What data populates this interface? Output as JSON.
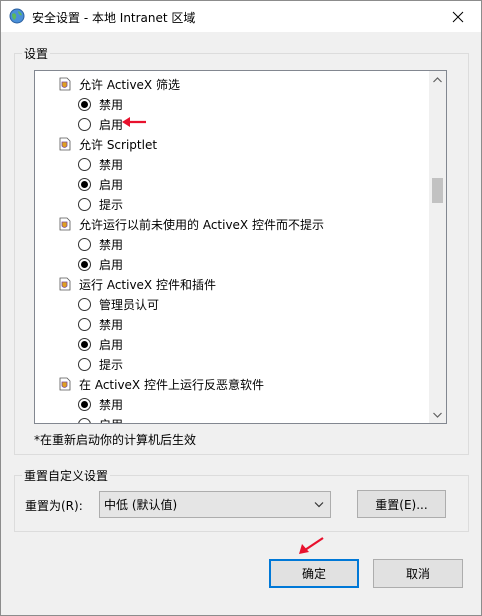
{
  "window": {
    "title": "安全设置 - 本地 Intranet 区域"
  },
  "settings_group": {
    "label": "设置",
    "items": [
      {
        "type": "header",
        "label": "允许 ActiveX 筛选"
      },
      {
        "type": "option",
        "label": "禁用",
        "checked": true
      },
      {
        "type": "option",
        "label": "启用",
        "checked": false
      },
      {
        "type": "header",
        "label": "允许 Scriptlet"
      },
      {
        "type": "option",
        "label": "禁用",
        "checked": false
      },
      {
        "type": "option",
        "label": "启用",
        "checked": true
      },
      {
        "type": "option",
        "label": "提示",
        "checked": false
      },
      {
        "type": "header",
        "label": "允许运行以前未使用的 ActiveX 控件而不提示"
      },
      {
        "type": "option",
        "label": "禁用",
        "checked": false
      },
      {
        "type": "option",
        "label": "启用",
        "checked": true
      },
      {
        "type": "header",
        "label": "运行 ActiveX 控件和插件"
      },
      {
        "type": "option",
        "label": "管理员认可",
        "checked": false
      },
      {
        "type": "option",
        "label": "禁用",
        "checked": false
      },
      {
        "type": "option",
        "label": "启用",
        "checked": true
      },
      {
        "type": "option",
        "label": "提示",
        "checked": false
      },
      {
        "type": "header",
        "label": "在 ActiveX 控件上运行反恶意软件"
      },
      {
        "type": "option",
        "label": "禁用",
        "checked": true
      },
      {
        "type": "option",
        "label": "启用",
        "checked": false
      }
    ],
    "note": "*在重新启动你的计算机后生效"
  },
  "reset_group": {
    "label": "重置自定义设置",
    "reset_to_label": "重置为(R):",
    "reset_level_value": "中低 (默认值)",
    "reset_button": "重置(E)..."
  },
  "footer": {
    "ok_button": "确定",
    "cancel_button": "取消"
  },
  "colors": {
    "accent": "#0078d7",
    "annotation_arrow": "#e8112d"
  }
}
